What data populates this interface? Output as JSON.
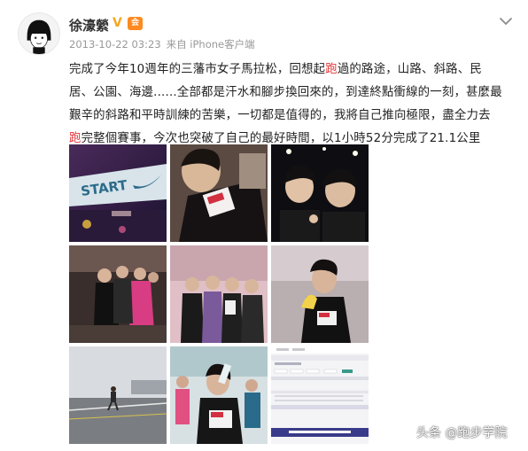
{
  "post": {
    "username": "徐濠縈",
    "verified_mark": "V",
    "vip_label": "会",
    "timestamp": "2013-10-22 03:23",
    "source_prefix": "来自",
    "source": "iPhone客户端",
    "text_lines": [
      "完成了今年10週年的三藩市女子馬拉松，回想起",
      "跑",
      "過的路途，山路、斜路、民",
      "居、公園、海邊......全部都是汗水和腳步換回來的，到達終點衝線的一刻，甚麼最",
      "艱辛的斜路和平時訓練的苦樂，一切都是值得的，我將自己推向極限，盡全力去",
      "跑",
      "完整個賽事，今次也突破了自己的最好時間，以1小時52分完成了21.1公里"
    ],
    "photos": [
      {
        "name": "photo-start-banner",
        "text": "START"
      },
      {
        "name": "photo-race-bib-selfie"
      },
      {
        "name": "photo-friends-selfie"
      },
      {
        "name": "photo-group-indoor"
      },
      {
        "name": "photo-group-stage"
      },
      {
        "name": "photo-banana"
      },
      {
        "name": "photo-runner-foggy-road"
      },
      {
        "name": "photo-drinking-water"
      },
      {
        "name": "photo-results-screenshot"
      }
    ]
  },
  "watermark": "头条 @跑步学院",
  "colors": {
    "highlight": "#e4393c",
    "meta": "#999999",
    "verified": "#f5a623",
    "vip": "#ff8a1f"
  },
  "icons": {
    "more": "chevron-down-icon",
    "verified": "verified-icon",
    "vip": "vip-badge-icon"
  }
}
